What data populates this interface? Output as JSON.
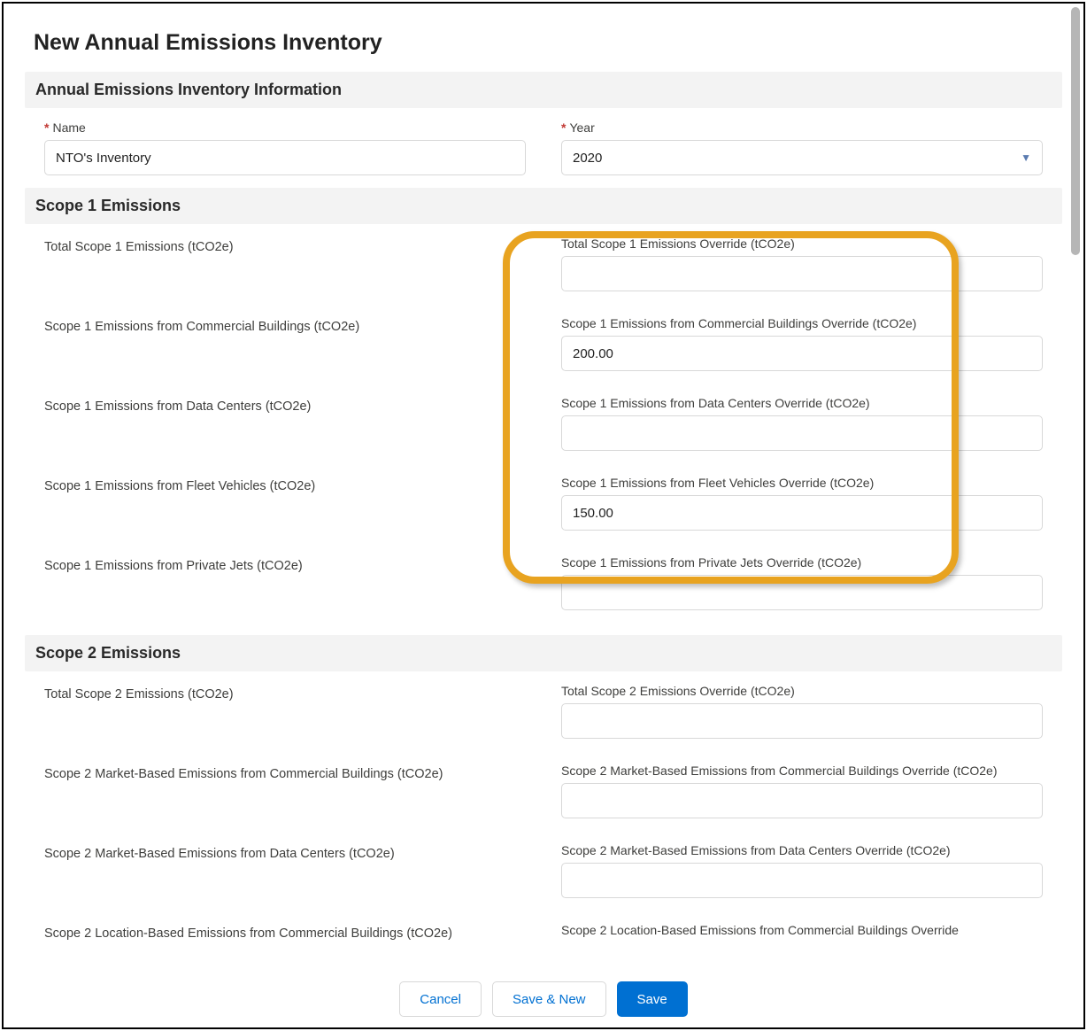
{
  "page_title": "New Annual Emissions Inventory",
  "sections": {
    "info": {
      "header": "Annual Emissions Inventory Information",
      "name_label": "Name",
      "name_value": "NTO's Inventory",
      "year_label": "Year",
      "year_value": "2020"
    },
    "scope1": {
      "header": "Scope 1 Emissions",
      "rows": [
        {
          "left": "Total Scope 1 Emissions (tCO2e)",
          "right_label": "Total Scope 1 Emissions Override (tCO2e)",
          "right_value": ""
        },
        {
          "left": "Scope 1 Emissions from Commercial Buildings (tCO2e)",
          "right_label": "Scope 1 Emissions from Commercial Buildings Override (tCO2e)",
          "right_value": "200.00"
        },
        {
          "left": "Scope 1 Emissions from Data Centers (tCO2e)",
          "right_label": "Scope 1 Emissions from Data Centers Override (tCO2e)",
          "right_value": ""
        },
        {
          "left": "Scope 1 Emissions from Fleet Vehicles (tCO2e)",
          "right_label": "Scope 1 Emissions from Fleet Vehicles Override (tCO2e)",
          "right_value": "150.00"
        },
        {
          "left": "Scope 1 Emissions from Private Jets (tCO2e)",
          "right_label": "Scope 1 Emissions from Private Jets Override (tCO2e)",
          "right_value": ""
        }
      ]
    },
    "scope2": {
      "header": "Scope 2 Emissions",
      "rows": [
        {
          "left": "Total Scope 2 Emissions (tCO2e)",
          "right_label": "Total Scope 2 Emissions Override (tCO2e)",
          "right_value": ""
        },
        {
          "left": "Scope 2 Market-Based Emissions from Commercial Buildings (tCO2e)",
          "right_label": "Scope 2 Market-Based Emissions from Commercial Buildings Override (tCO2e)",
          "right_value": ""
        },
        {
          "left": "Scope 2 Market-Based Emissions from Data Centers (tCO2e)",
          "right_label": "Scope 2 Market-Based Emissions from Data Centers Override (tCO2e)",
          "right_value": ""
        },
        {
          "left": "Scope 2 Location-Based Emissions from Commercial Buildings (tCO2e)",
          "right_label": "Scope 2 Location-Based Emissions from Commercial Buildings Override",
          "right_value": ""
        }
      ]
    }
  },
  "footer": {
    "cancel": "Cancel",
    "save_new": "Save & New",
    "save": "Save"
  }
}
